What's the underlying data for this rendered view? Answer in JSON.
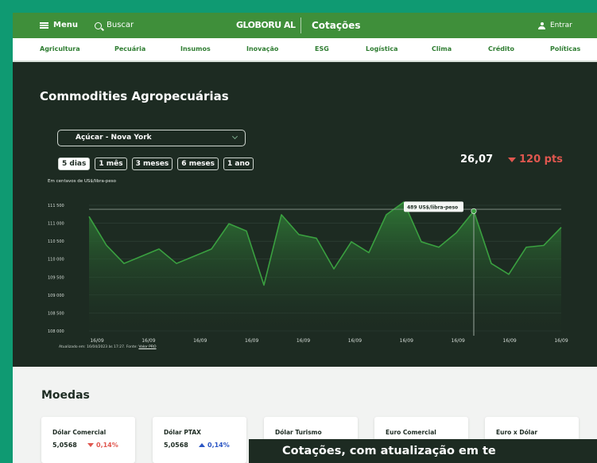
{
  "header": {
    "menu_label": "Menu",
    "search_label": "Buscar",
    "logo_text": "GLOBORU AL",
    "section_title": "Cotações",
    "login_label": "Entrar"
  },
  "nav": {
    "items": [
      "Agricultura",
      "Pecuária",
      "Insumos",
      "Inovação",
      "ESG",
      "Logística",
      "Clima",
      "Crédito",
      "Políticas"
    ]
  },
  "page": {
    "title": "Commodities Agropecuárias"
  },
  "commodity": {
    "selected": "Açúcar - Nova York",
    "ranges": [
      "5 dias",
      "1 mês",
      "3 meses",
      "6 meses",
      "1 ano"
    ],
    "active_range": "5 dias",
    "price": "26,07",
    "delta": "120 pts",
    "unit": "Em centavos de US$/libra-peso",
    "tooltip": "489 US$/libra-peso",
    "footnote_prefix": "Atualizado em: 16/04/2023 às 17:27. Fonte:",
    "footnote_source": "Valor PRO"
  },
  "chart_data": {
    "type": "area",
    "y_ticks": [
      "111 500",
      "111 000",
      "110 500",
      "110 000",
      "109 500",
      "109 000",
      "108 500",
      "108 000"
    ],
    "ylim": [
      108000,
      111700
    ],
    "x_ticks": [
      "16/09",
      "16/09",
      "16/09",
      "16/09",
      "16/09",
      "16/09",
      "16/09",
      "16/09",
      "16/09",
      "16/09"
    ],
    "values": [
      111300,
      110500,
      110000,
      110200,
      110400,
      110000,
      110200,
      110400,
      111100,
      110900,
      109400,
      111350,
      110800,
      110700,
      109850,
      110600,
      110300,
      111350,
      111700,
      110600,
      110450,
      110850,
      111450,
      110000,
      109700,
      110450,
      110500,
      111000
    ],
    "highlight_index": 22,
    "reference_line": 111500,
    "colors": {
      "line": "#3aa040",
      "fill_top": "#2f7a36",
      "fill_bottom": "#1d2b22",
      "grid": "#33443a"
    }
  },
  "moedas": {
    "title": "Moedas",
    "cards": [
      {
        "name": "Dólar Comercial",
        "value": "5,0568",
        "change": "0,14%",
        "direction": "down"
      },
      {
        "name": "Dólar PTAX",
        "value": "5,0568",
        "change": "0,14%",
        "direction": "up"
      },
      {
        "name": "Dólar Turismo",
        "value": "",
        "change": "",
        "direction": ""
      },
      {
        "name": "Euro Comercial",
        "value": "",
        "change": "",
        "direction": ""
      },
      {
        "name": "Euro x Dólar",
        "value": "",
        "change": "",
        "direction": ""
      }
    ]
  },
  "caption": {
    "text": "Cotações, com atualização em te"
  }
}
